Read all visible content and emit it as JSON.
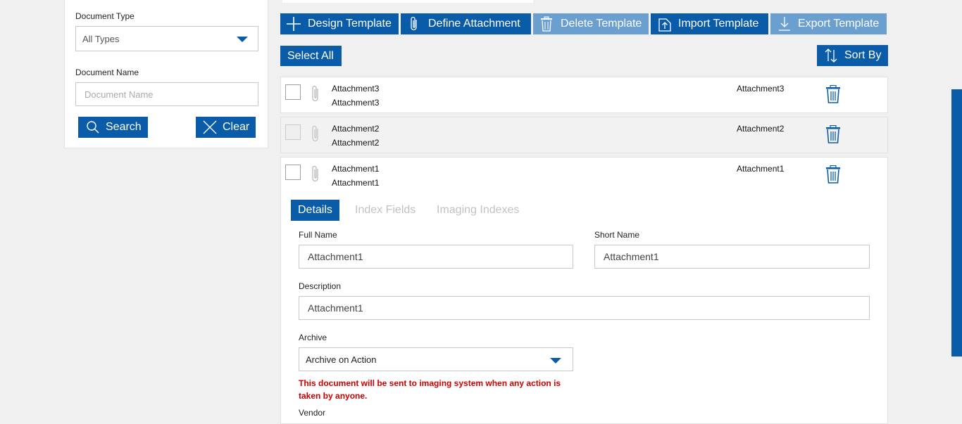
{
  "filters": {
    "document_type_label": "Document Type",
    "document_type_value": "All Types",
    "document_name_label": "Document Name",
    "document_name_placeholder": "Document Name",
    "search_label": "Search",
    "clear_label": "Clear"
  },
  "toolbar": {
    "design_template": "Design Template",
    "define_attachment": "Define Attachment",
    "delete_template": "Delete Template",
    "import_template": "Import Template",
    "export_template": "Export Template",
    "select_all": "Select All",
    "sort_by": "Sort By"
  },
  "rows": [
    {
      "name": "Attachment3",
      "description": "Attachment3",
      "short_name": "Attachment3"
    },
    {
      "name": "Attachment2",
      "description": "Attachment2",
      "short_name": "Attachment2"
    },
    {
      "name": "Attachment1",
      "description": "Attachment1",
      "short_name": "Attachment1"
    }
  ],
  "details": {
    "tabs": [
      "Details",
      "Index Fields",
      "Imaging Indexes"
    ],
    "full_name_label": "Full Name",
    "full_name_value": "Attachment1",
    "short_name_label": "Short Name",
    "short_name_value": "Attachment1",
    "description_label": "Description",
    "description_value": "Attachment1",
    "archive_label": "Archive",
    "archive_value": "Archive on Action",
    "archive_warning": "This document will be sent to imaging system when any action is taken by anyone.",
    "vendor_label": "Vendor"
  },
  "colors": {
    "accent": "#0b5ca8",
    "accent_disabled": "#6a9fd0",
    "warning": "#cc0000"
  }
}
